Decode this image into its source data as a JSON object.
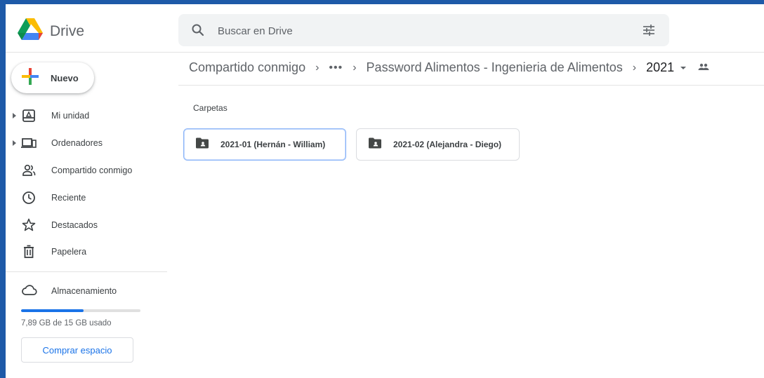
{
  "app": {
    "name": "Drive"
  },
  "search": {
    "placeholder": "Buscar en Drive"
  },
  "sidebar": {
    "new_label": "Nuevo",
    "items": [
      {
        "label": "Mi unidad",
        "icon": "my-drive-icon",
        "expandable": true
      },
      {
        "label": "Ordenadores",
        "icon": "computers-icon",
        "expandable": true
      },
      {
        "label": "Compartido conmigo",
        "icon": "shared-with-me-icon",
        "expandable": false
      },
      {
        "label": "Reciente",
        "icon": "clock-icon",
        "expandable": false
      },
      {
        "label": "Destacados",
        "icon": "star-icon",
        "expandable": false
      },
      {
        "label": "Papelera",
        "icon": "trash-icon",
        "expandable": false
      }
    ],
    "storage": {
      "label": "Almacenamiento",
      "usage_text": "7,89 GB de 15 GB usado",
      "used_fraction": 0.526,
      "buy_label": "Comprar espacio"
    }
  },
  "breadcrumb": {
    "items": [
      "Compartido conmigo",
      "•••",
      "Password Alimentos - Ingenieria de Alimentos",
      "2021"
    ]
  },
  "main": {
    "section_title": "Carpetas",
    "folders": [
      {
        "name": "2021-01 (Hernán - William)",
        "selected": true
      },
      {
        "name": "2021-02 (Alejandra - Diego)",
        "selected": false
      }
    ]
  },
  "colors": {
    "accent": "#1a73e8",
    "frame": "#1e5aa8",
    "icon": "#5f6368",
    "folder_icon": "#444746"
  }
}
